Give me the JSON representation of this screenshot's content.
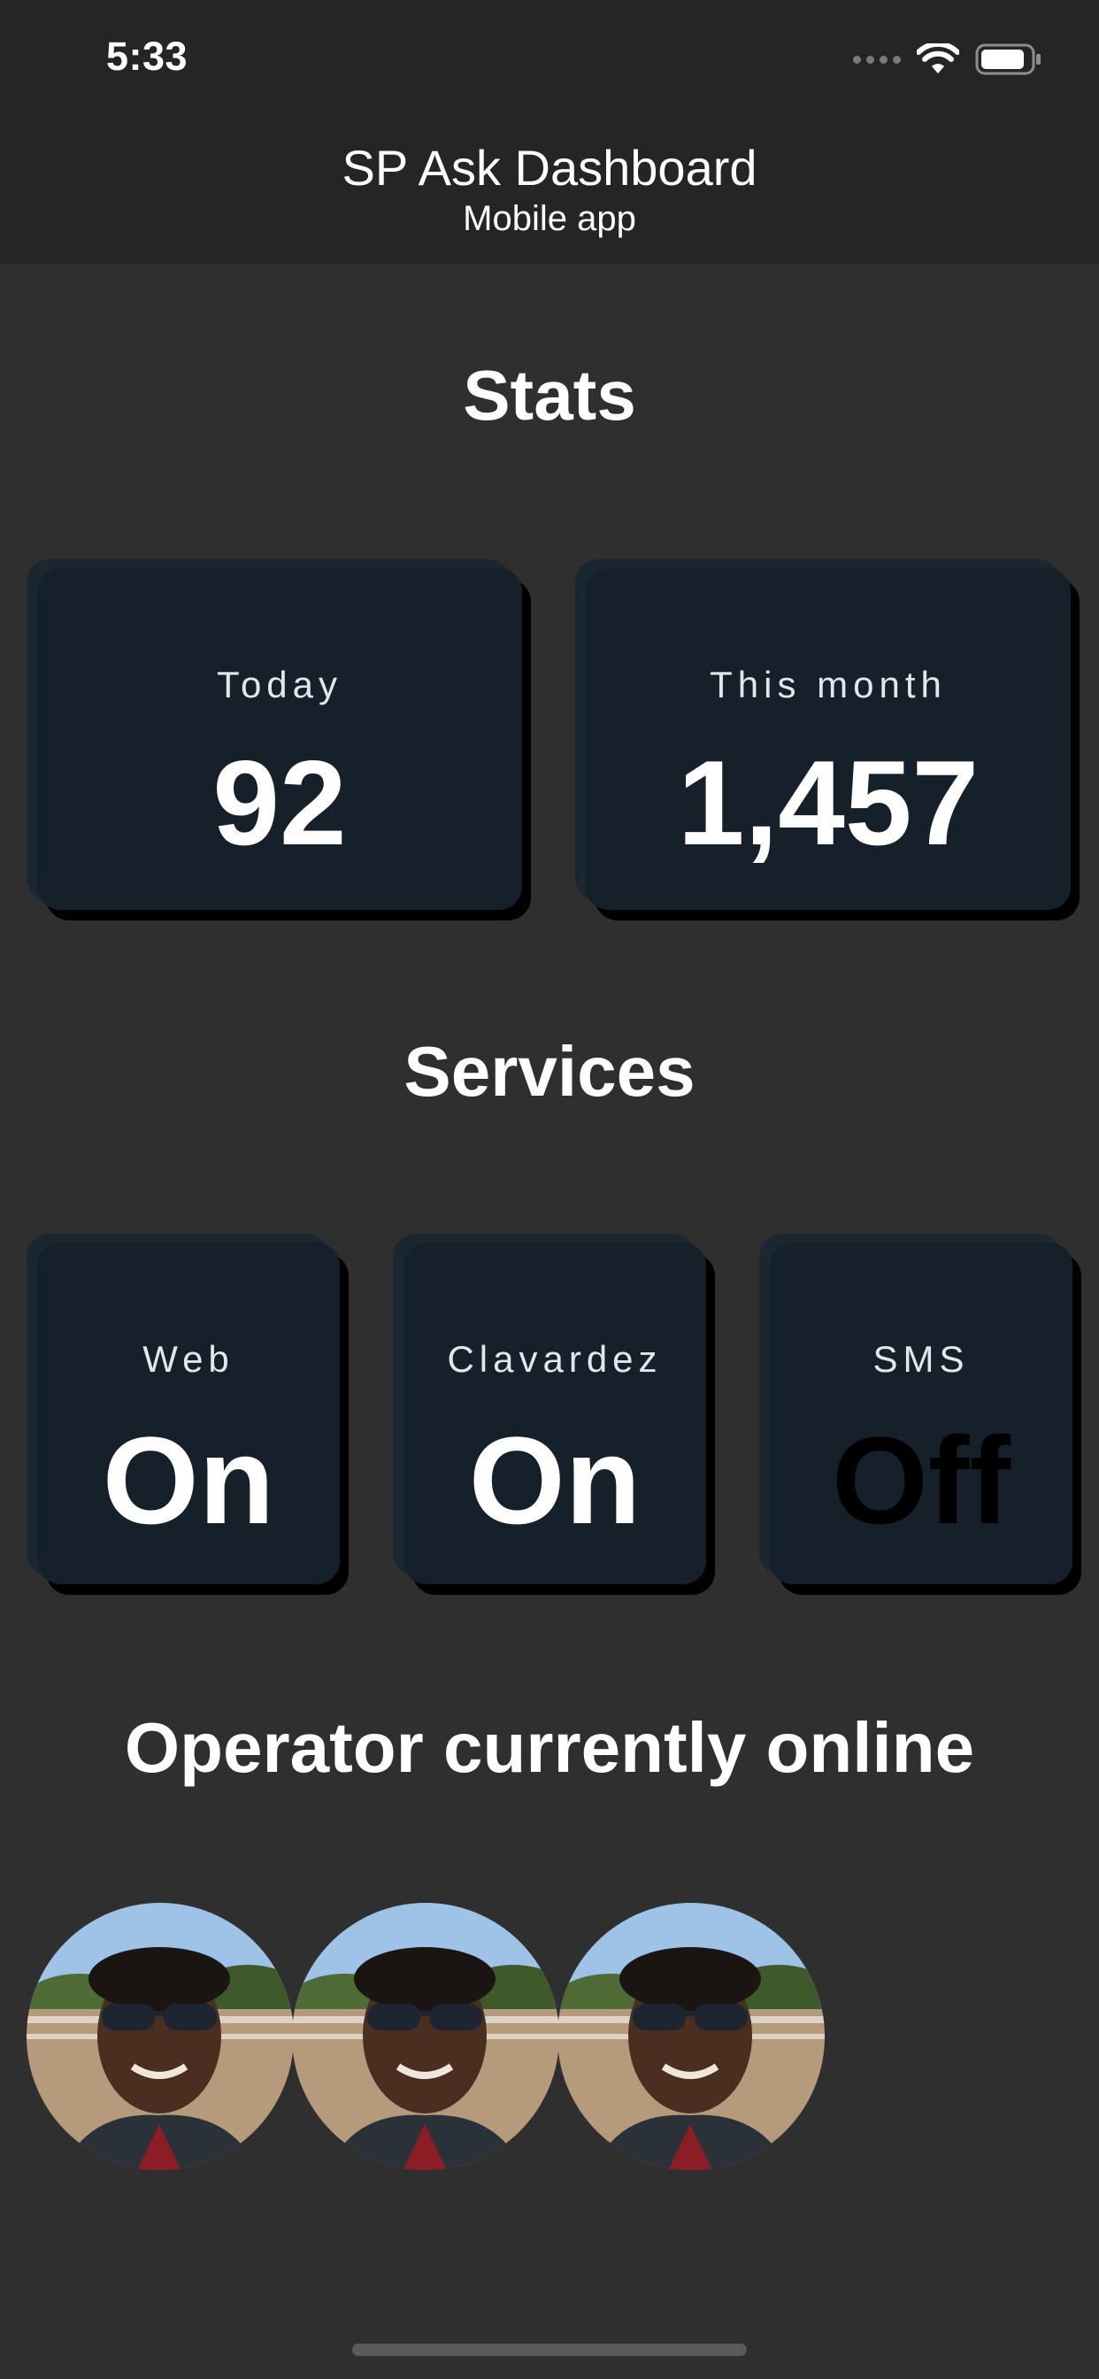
{
  "status_bar": {
    "time": "5:33"
  },
  "header": {
    "title": "SP Ask Dashboard",
    "subtitle": "Mobile app"
  },
  "stats": {
    "title": "Stats",
    "cards": [
      {
        "label": "Today",
        "value": "92"
      },
      {
        "label": "This month",
        "value": "1,457"
      }
    ]
  },
  "services": {
    "title": "Services",
    "cards": [
      {
        "label": "Web",
        "value": "On"
      },
      {
        "label": "Clavardez",
        "value": "On"
      },
      {
        "label": "SMS",
        "value": "Off"
      }
    ]
  },
  "operators": {
    "title": "Operator currently online",
    "avatars": [
      "operator-photo",
      "operator-photo",
      "operator-photo"
    ]
  },
  "colors": {
    "background": "#2f2f2f",
    "header_background": "#252525",
    "card_background": "#16202a",
    "service_on": "#ffffff",
    "service_off": "#000000"
  }
}
